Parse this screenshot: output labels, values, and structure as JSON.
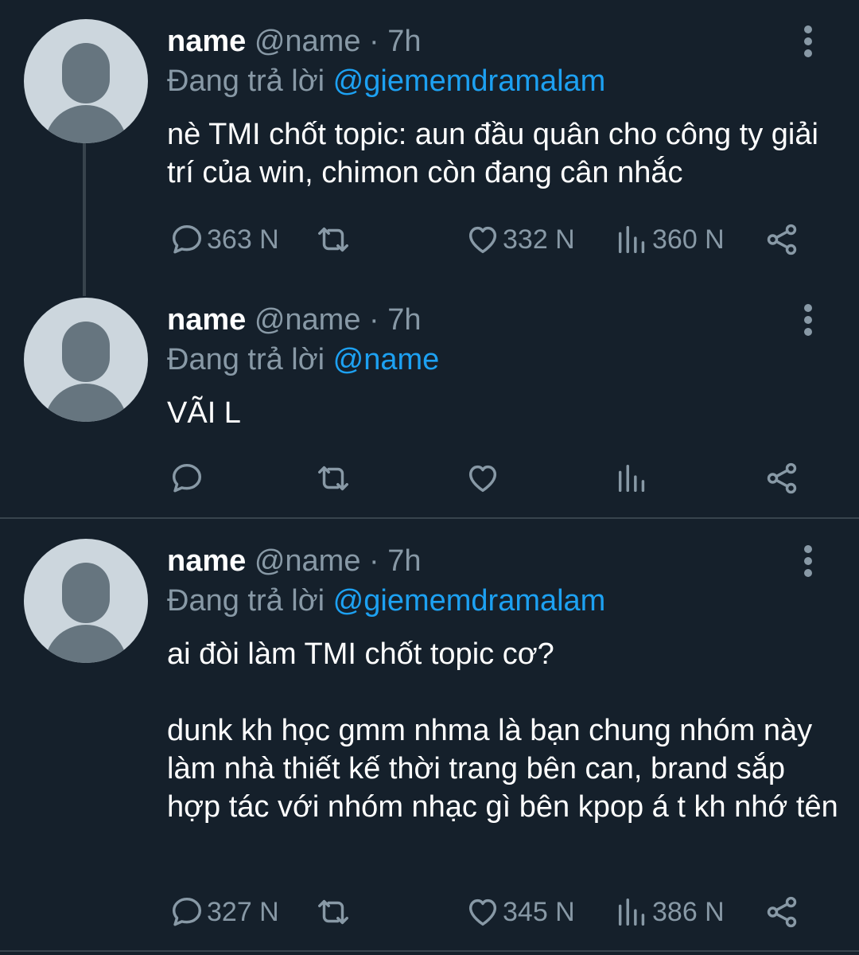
{
  "tweets": [
    {
      "display_name": "name",
      "handle": "@name",
      "separator": "·",
      "time": "7h",
      "reply_prefix": "Đang trả lời",
      "reply_to": "@giememdramalam",
      "text": "nè TMI chốt topic: aun đầu quân cho công ty giải trí của win, chimon còn đang cân nhắc",
      "replies": "363 N",
      "retweets": "",
      "likes": "332 N",
      "views": "360 N"
    },
    {
      "display_name": "name",
      "handle": "@name",
      "separator": "·",
      "time": "7h",
      "reply_prefix": "Đang trả lời",
      "reply_to": "@name",
      "text": "VÃI L",
      "replies": "",
      "retweets": "",
      "likes": "",
      "views": ""
    },
    {
      "display_name": "name",
      "handle": "@name",
      "separator": "·",
      "time": "7h",
      "reply_prefix": "Đang trả lời",
      "reply_to": "@giememdramalam",
      "text": "ai đòi làm TMI chốt topic cơ?\n\ndunk kh học gmm nhma là bạn chung nhóm này làm nhà thiết kế thời trang bên can, brand sắp hợp tác với nhóm nhạc gì bên kpop á t kh nhớ tên",
      "replies": "327 N",
      "retweets": "",
      "likes": "345 N",
      "views": "386 N"
    }
  ],
  "icons": {
    "reply": "speech-bubble-icon",
    "retweet": "retweet-icon",
    "like": "heart-icon",
    "views": "bar-chart-icon",
    "share": "share-icon",
    "more": "more-vertical-icon"
  },
  "colors": {
    "background": "#15202b",
    "accent": "#1da1f2",
    "secondary_text": "#8899a6",
    "divider": "#38444d"
  }
}
